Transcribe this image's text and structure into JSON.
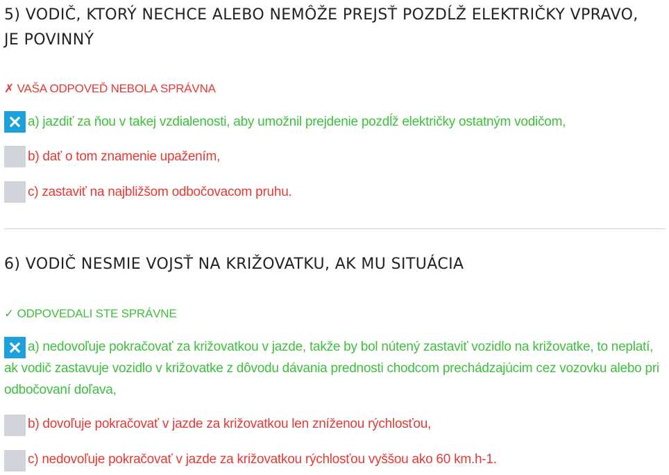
{
  "questions": [
    {
      "title": "5) VODIČ, KTORÝ NECHCE ALEBO NEMÔŽE PREJSŤ POZDĹŽ ELEKTRIČKY VPRAVO, JE POVINNÝ",
      "result": "✗ VAŠA ODPOVEĎ NEBOLA SPRÁVNA",
      "answers": [
        {
          "text": "a) jazdiť za ňou v takej vzdialenosti, aby umožnil prejdenie pozdĺž električky ostatným vodičom,",
          "selected": true,
          "correct": true
        },
        {
          "text": "b) dať o tom znamenie upažením,",
          "selected": false,
          "correct": false
        },
        {
          "text": "c) zastaviť na najbližšom odbočovacom pruhu.",
          "selected": false,
          "correct": false
        }
      ]
    },
    {
      "title": "6) VODIČ NESMIE VOJSŤ NA KRIŽOVATKU, AK MU SITUÁCIA",
      "result": "✓ ODPOVEDALI STE SPRÁVNE",
      "answers": [
        {
          "text": "a) nedovoľuje pokračovať za križovatkou v jazde, takže by bol nútený zastaviť vozidlo na križovatke, to neplatí, ak vodič zastavuje vozidlo v križovatke z dôvodu dávania prednosti chodcom prechádzajúcim cez vozovku alebo pri odbočovaní doľava,",
          "selected": true,
          "correct": true
        },
        {
          "text": "b) dovoľuje pokračovať v jazde za križovatkou len zníženou rýchlosťou,",
          "selected": false,
          "correct": false
        },
        {
          "text": "c) nedovoľuje pokračovať v jazde za križovatkou rýchlosťou vyššou ako 60 km.h-1.",
          "selected": false,
          "correct": false
        }
      ]
    }
  ],
  "colors": {
    "correct_text": "#3dbf3d",
    "incorrect_text": "#e53935",
    "checkbox_checked": "#1da1dc",
    "checkbox_unchecked": "#d0d3d9",
    "title_text": "#222222"
  },
  "icons": {
    "checked_mark": "close-icon"
  }
}
